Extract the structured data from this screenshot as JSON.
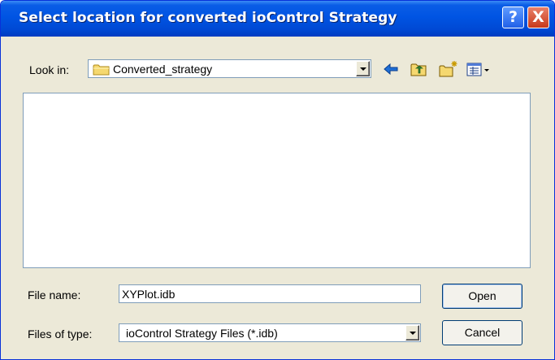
{
  "window": {
    "title": "Select location for converted ioControl Strategy"
  },
  "title_buttons": {
    "help": "?",
    "close": "X"
  },
  "look_in": {
    "label": "Look in:",
    "value": "Converted_strategy",
    "icon": "folder-icon"
  },
  "toolbar": {
    "icons": [
      "back-arrow-icon",
      "up-one-level-icon",
      "create-new-folder-icon",
      "view-menu-icon"
    ]
  },
  "file_list": {
    "items": []
  },
  "file_name": {
    "label": "File name:",
    "value": "XYPlot.idb"
  },
  "files_of_type": {
    "label": "Files of type:",
    "value": "ioControl Strategy Files (*.idb)"
  },
  "buttons": {
    "open": "Open",
    "cancel": "Cancel"
  },
  "colors": {
    "titlebar": "#0054e3",
    "dialog_bg": "#ece9d8",
    "field_border": "#7f9db9",
    "button_border": "#003c74"
  }
}
